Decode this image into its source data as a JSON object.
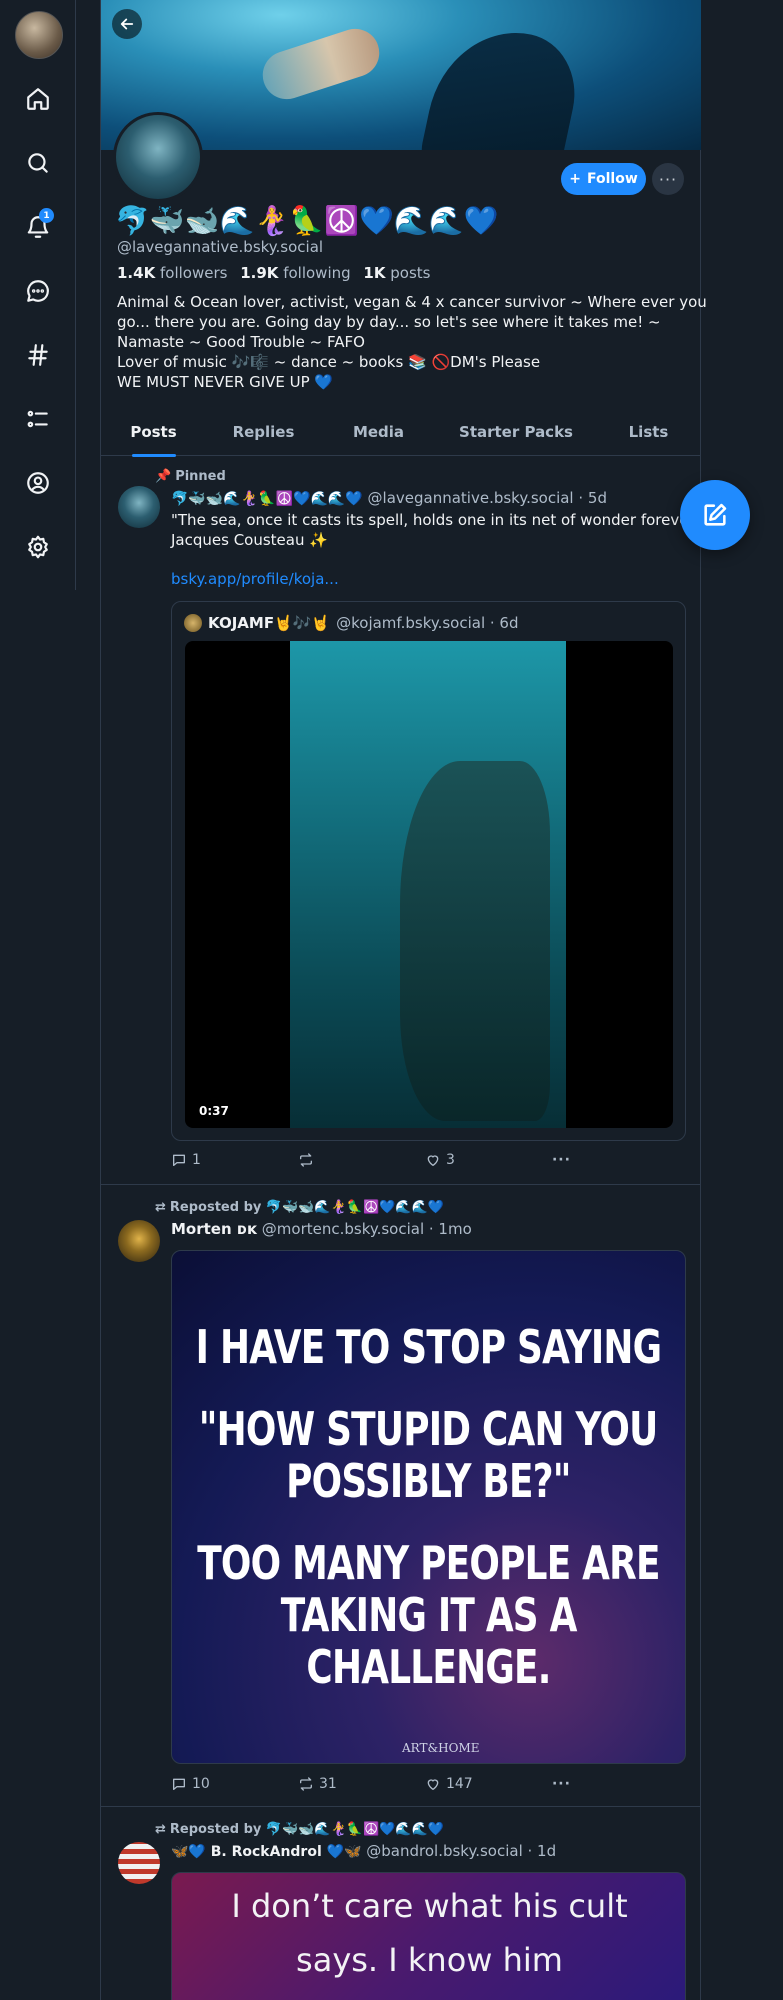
{
  "nav": {
    "notifications_count": "1"
  },
  "profile": {
    "display_name": "🐬🐳🐋🌊🧜‍♀️🦜☮️💙🌊🌊💙",
    "handle": "@lavegannative.bsky.social",
    "followers_count": "1.4K",
    "followers_label": "followers",
    "following_count": "1.9K",
    "following_label": "following",
    "posts_count": "1K",
    "posts_label": "posts",
    "bio": [
      "Animal & Ocean lover, activist, vegan & 4 x cancer survivor ~ Where ever you",
      "go... there you are. Going day by day... so let's see where it takes me! ~",
      "Namaste ~ Good Trouble ~ FAFO",
      "Lover of music 🎶🎼 ~ dance ~ books 📚 🚫DM's Please",
      "WE MUST NEVER GIVE UP 💙"
    ],
    "follow_label": "Follow",
    "more_label": "···"
  },
  "tabs": [
    "Posts",
    "Replies",
    "Media",
    "Starter Packs",
    "Lists"
  ],
  "posts": [
    {
      "meta": "Pinned",
      "author": "🐬🐳🐋🌊🧜‍♀️🦜☮️💙🌊🌊💙",
      "handle_time": "@lavegannative.bsky.social · 5d",
      "text_line1": "\"The sea, once it casts its spell, holds one in its net of wonder forever.\" -",
      "text_line2": "Jacques Cousteau ✨",
      "link": "bsky.app/profile/koja...",
      "quote": {
        "author": "KOJAMF🤘🎶🤘",
        "handle_time": "@kojamf.bsky.social · 6d",
        "duration": "0:37"
      },
      "replies": "1",
      "reposts": "",
      "likes": "3"
    },
    {
      "meta": "Reposted by 🐬🐳🐋🌊🧜‍♀️🦜☮️💙🌊🌊💙",
      "author": "Morten ᴅᴋ",
      "handle_time": "@mortenc.bsky.social · 1mo",
      "image_lines_a": [
        "I HAVE TO STOP SAYING"
      ],
      "image_lines_b": [
        "\"HOW STUPID CAN YOU",
        "POSSIBLY BE?\""
      ],
      "image_lines_c": [
        "TOO MANY PEOPLE ARE",
        "TAKING IT AS A",
        "CHALLENGE."
      ],
      "image_credit": "ART&HOME",
      "replies": "10",
      "reposts": "31",
      "likes": "147"
    },
    {
      "meta": "Reposted by 🐬🐳🐋🌊🧜‍♀️🦜☮️💙🌊🌊💙",
      "author": "🦋💙 B. RockAndrol 💙🦋",
      "handle_time": "@bandrol.bsky.social · 1d",
      "image_lines": [
        "I don’t care what his cult",
        "says. I know him"
      ]
    }
  ]
}
